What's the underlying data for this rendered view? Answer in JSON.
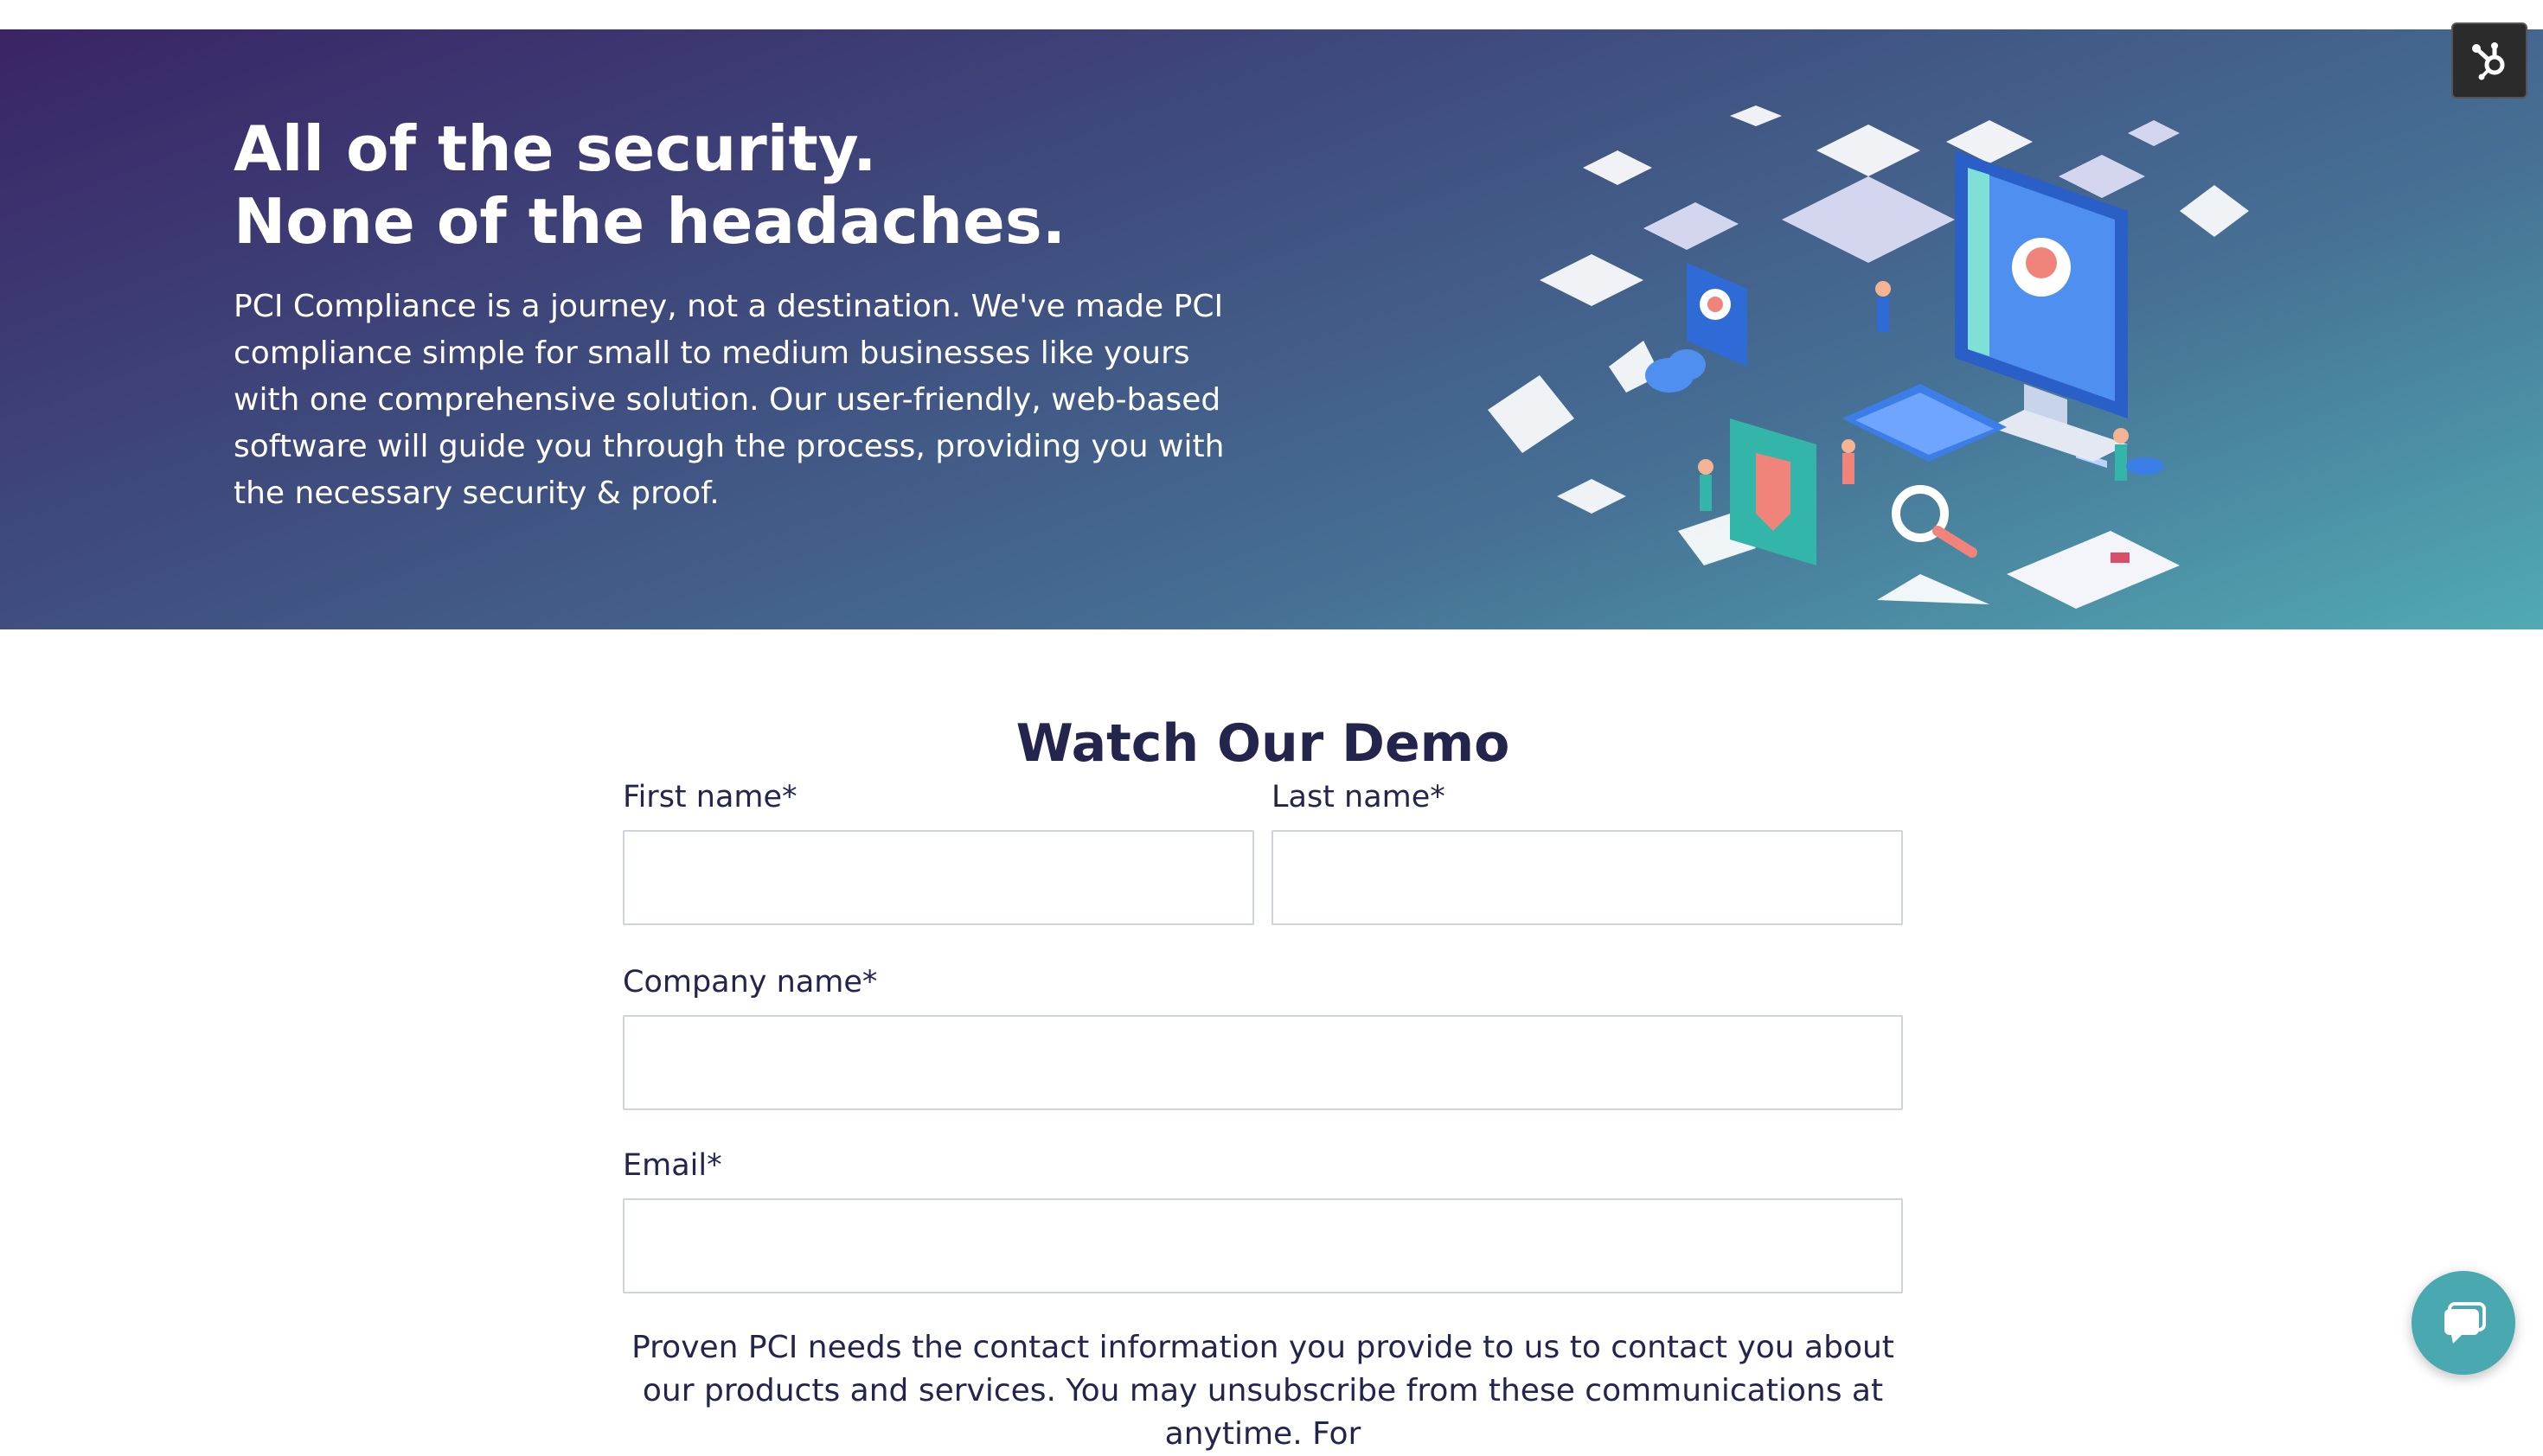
{
  "hero": {
    "title_line1": "All of the security.",
    "title_line2": "None of the headaches.",
    "body": "PCI Compliance is a journey, not a destination. We've made PCI compliance simple for small to medium businesses like yours with one comprehensive solution. Our user-friendly, web-based software will guide you through the process, providing you with the necessary security & proof."
  },
  "form": {
    "title": "Watch Our Demo",
    "first_name_label": "First name*",
    "first_name_value": "",
    "last_name_label": "Last name*",
    "last_name_value": "",
    "company_label": "Company name*",
    "company_value": "",
    "email_label": "Email*",
    "email_value": "",
    "consent_text": "Proven PCI needs the contact information you provide to us to contact you about our products and services. You may unsubscribe from these communications at anytime. For"
  },
  "widgets": {
    "hubspot_icon": "hubspot-sprocket-icon",
    "chat_icon": "chat-bubble-icon"
  },
  "colors": {
    "hero_gradient_start": "#3a2466",
    "hero_gradient_end": "#51aab3",
    "heading_text": "#24254d",
    "chat_button": "#4aa8b0"
  }
}
